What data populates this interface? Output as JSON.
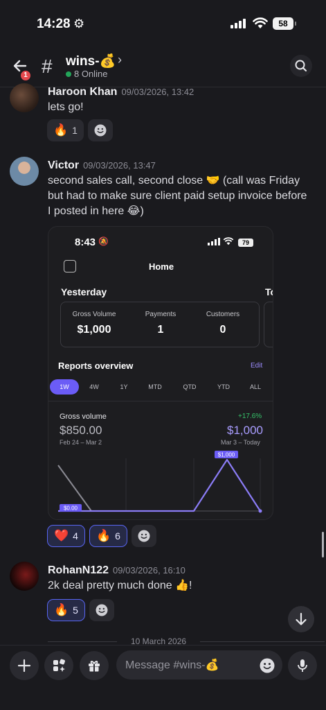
{
  "status_bar": {
    "time": "14:28",
    "battery": "58"
  },
  "header": {
    "back_badge": "1",
    "channel_name": "wins-💰",
    "online_text": "8 Online"
  },
  "messages": [
    {
      "author": "Haroon Khan",
      "timestamp": "09/03/2026, 13:42",
      "text": "lets go!",
      "reactions": [
        {
          "emoji": "🔥",
          "count": "1"
        }
      ]
    },
    {
      "author": "Victor",
      "timestamp": "09/03/2026, 13:47",
      "text": "second sales call, second close 🤝 (call was Friday but had to make sure client paid setup invoice before I posted in here 😂)",
      "reactions": [
        {
          "emoji": "❤️",
          "count": "4"
        },
        {
          "emoji": "🔥",
          "count": "6"
        }
      ]
    },
    {
      "author": "RohanN122",
      "timestamp": "09/03/2026, 16:10",
      "text": "2k deal pretty much done 👍!",
      "reactions": [
        {
          "emoji": "🔥",
          "count": "5"
        }
      ]
    }
  ],
  "embed": {
    "time": "8:43",
    "battery": "79",
    "title": "Home",
    "yesterday_label": "Yesterday",
    "today_label": "To",
    "stats": [
      {
        "label": "Gross Volume",
        "value": "$1,000"
      },
      {
        "label": "Payments",
        "value": "1"
      },
      {
        "label": "Customers",
        "value": "0"
      }
    ],
    "reports_title": "Reports overview",
    "edit_label": "Edit",
    "ranges": [
      "1W",
      "4W",
      "1Y",
      "MTD",
      "QTD",
      "YTD",
      "ALL"
    ],
    "selected_range": "1W",
    "gross_volume_label": "Gross volume",
    "change": "+17.6%",
    "previous_value": "$850.00",
    "current_value": "$1,000",
    "previous_range": "Feb 24 – Mar 2",
    "current_range": "Mar 3 – Today",
    "chart_labels": {
      "peak": "$1,000",
      "baseline": "$0.00"
    }
  },
  "date_divider": "10 March 2026",
  "composer": {
    "placeholder": "Message #wins-💰"
  },
  "colors": {
    "accent": "#5865f2",
    "online": "#23a55a",
    "badge": "#e5484d",
    "chart_purple": "#8b7cf6"
  }
}
